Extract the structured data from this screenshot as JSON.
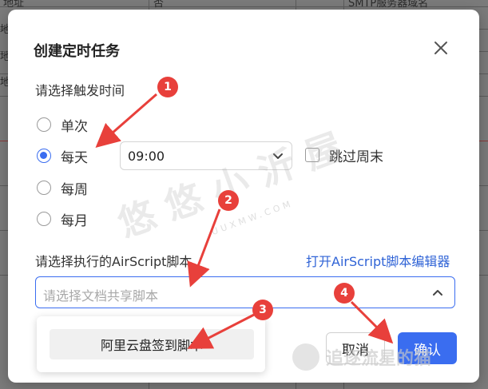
{
  "background_sheet": {
    "cells": [
      "地址",
      "否",
      "SMTP服务器域名"
    ],
    "side_marks": [
      "地",
      "地",
      "地"
    ]
  },
  "dialog": {
    "title": "创建定时任务",
    "close_icon": "close-icon",
    "trigger_label": "请选择触发时间",
    "frequency_options": [
      "单次",
      "每天",
      "每周",
      "每月"
    ],
    "selected_frequency": "每天",
    "time_value": "09:00",
    "skip_weekend_label": "跳过周末",
    "skip_weekend_checked": false,
    "script_label": "请选择执行的AirScript脚本",
    "open_editor_link": "打开AirScript脚本编辑器",
    "script_placeholder": "请选择文档共享脚本",
    "script_options": [
      "阿里云盘签到脚本"
    ],
    "cancel_label": "取消",
    "confirm_label": "确认"
  },
  "annotations": {
    "badges": [
      "1",
      "2",
      "3",
      "4"
    ],
    "badge_color": "#e8403b"
  },
  "watermark": {
    "text": "悠 悠 小 沂 屋",
    "sub": "UUXMW.COM",
    "brand": "追逐流星的猫"
  },
  "colors": {
    "accent": "#3a6df0",
    "link": "#2f63d6",
    "overlay": "#7d7d7d"
  }
}
